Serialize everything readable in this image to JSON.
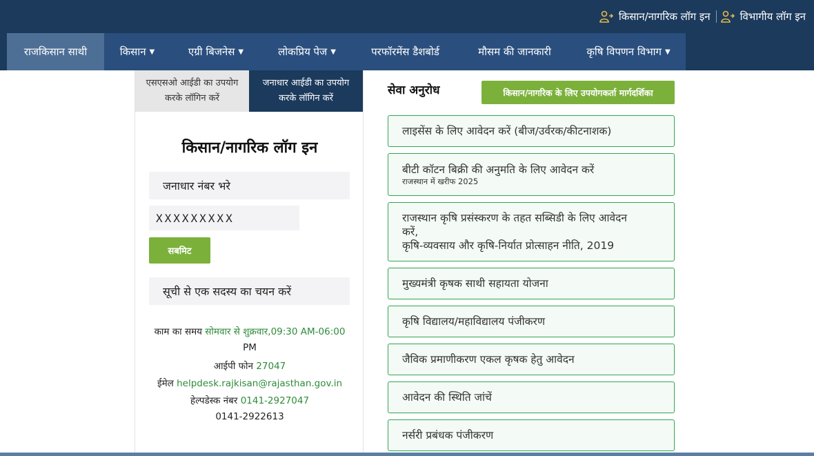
{
  "header": {
    "farmer_login": "किसान/नागरिक लॉग इन",
    "dept_login": "विभागीय लॉग इन"
  },
  "nav": {
    "items": [
      {
        "label": "राजकिसान साथी"
      },
      {
        "label": "किसान"
      },
      {
        "label": "एग्री बिजनेस"
      },
      {
        "label": "लोकप्रिय पेज"
      },
      {
        "label": "परफॉरमेंस डैशबोर्ड"
      },
      {
        "label": "मौसम की जानकारी"
      },
      {
        "label": "कृषि विपणन विभाग"
      }
    ]
  },
  "login_panel": {
    "tab_sso": "एसएसओ आईडी का उपयोग करके लॉगिन करें",
    "tab_janaadhar": "जनाधार आईडी का उपयोग करके लॉगिन करें",
    "title": "किसान/नागरिक लॉग इन",
    "janaadhar_placeholder": "जनाधार नंबर भरे",
    "janaadhar_value": "XXXXXXXXX",
    "submit_label": "सबमिट",
    "member_select": "सूची से एक सदस्य का चयन करें",
    "work_time_label": "काम का समय",
    "work_days": "सोमवार से शुक्रवार",
    "work_hours_a": ",09:30 AM-06:00",
    "work_hours_b": "PM",
    "ip_phone_label": "आईपी फोन",
    "ip_phone": "27047",
    "email_label": "ईमेल",
    "email": "helpdesk.rajkisan@rajasthan.gov.in",
    "helpdesk_label": "हेल्पडेस्क नंबर",
    "helpdesk_1": "0141-2927047",
    "helpdesk_2": "0141-2922613"
  },
  "services": {
    "title": "सेवा अनुरोध",
    "guide_button": "किसान/नागरिक के लिए उपयोगकर्ता मार्गदर्शिका",
    "items": [
      {
        "title": "लाइसेंस के लिए आवेदन करें (बीज/उर्वरक/कीटनाशक)"
      },
      {
        "title": "बीटी कॉटन बिक्री की अनुमति के लिए आवेदन करें",
        "subtitle": "राजस्थान में खरीफ 2025"
      },
      {
        "line1": "राजस्थान कृषि प्रसंस्करण के तहत सब्सिडी के लिए आवेदन",
        "line2": "करें,",
        "line3": "कृषि-व्यवसाय और कृषि-निर्यात प्रोत्साहन नीति, 2019"
      },
      {
        "title": "मुख्यमंत्री कृषक साथी सहायता योजना"
      },
      {
        "title": "कृषि विद्यालय/महाविद्यालय पंजीकरण"
      },
      {
        "title": "जैविक प्रमाणीकरण एकल कृषक हेतु आवेदन"
      },
      {
        "title": "आवेदन की स्थिति जांचें"
      },
      {
        "title": "नर्सरी प्रबंधक पंजीकरण"
      }
    ]
  },
  "colors": {
    "header_bg": "#1b3a5c",
    "nav_bg": "#2a4f7e",
    "accent_green": "#7bb13a",
    "card_border": "#2fa552"
  }
}
